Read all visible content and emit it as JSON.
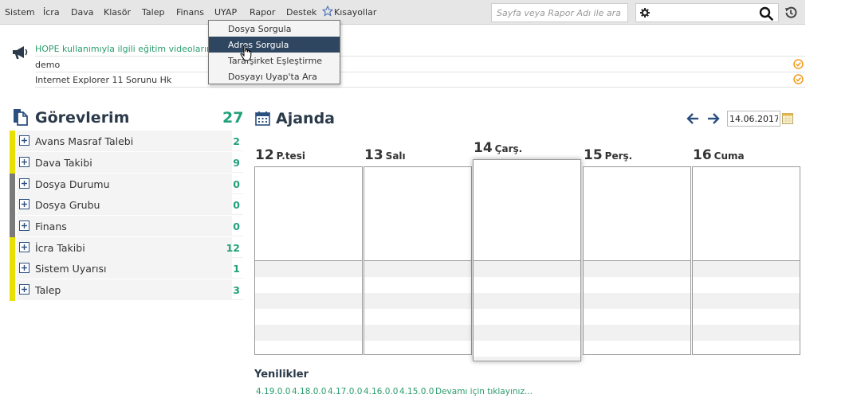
{
  "menubar": {
    "items": [
      "Sistem",
      "İcra",
      "Dava",
      "Klasör",
      "Talep",
      "Finans",
      "UYAP",
      "Rapor",
      "Destek"
    ],
    "shortcuts_label": "Kısayollar",
    "rapor_search_placeholder": "Sayfa veya Rapor Adı ile ara",
    "main_search_value": ""
  },
  "uyap_dropdown": {
    "items": [
      "Dosya Sorgula",
      "Adres Sorgula",
      "Tarafşirket Eşleştirme",
      "Dosyayı Uyap'ta Ara"
    ],
    "selected_index": 1
  },
  "announcements": [
    "HOPE kullanımıyla ilgili eğitim videolarımıza",
    "demo",
    "Internet Explorer 11 Sorunu Hk"
  ],
  "tasks": {
    "title": "Görevlerim",
    "total": "27",
    "items": [
      {
        "label": "Avans Masraf Talebi",
        "count": "2",
        "color": "#e8e000"
      },
      {
        "label": "Dava Takibi",
        "count": "9",
        "color": "#e8e000"
      },
      {
        "label": "Dosya Durumu",
        "count": "0",
        "color": "#7a7a7a"
      },
      {
        "label": "Dosya Grubu",
        "count": "0",
        "color": "#7a7a7a"
      },
      {
        "label": "Finans",
        "count": "0",
        "color": "#7a7a7a"
      },
      {
        "label": "İcra Takibi",
        "count": "12",
        "color": "#e8e000"
      },
      {
        "label": "Sistem Uyarısı",
        "count": "1",
        "color": "#e8e000"
      },
      {
        "label": "Talep",
        "count": "3",
        "color": "#e8e000"
      }
    ]
  },
  "agenda": {
    "title": "Ajanda",
    "date": "14.06.2017",
    "days": [
      {
        "num": "12",
        "name": "P.tesi"
      },
      {
        "num": "13",
        "name": "Salı"
      },
      {
        "num": "14",
        "name": "Çarş."
      },
      {
        "num": "15",
        "name": "Perş."
      },
      {
        "num": "16",
        "name": "Cuma"
      }
    ],
    "today_index": 2
  },
  "news": {
    "title": "Yenilikler",
    "versions": [
      "4.19.0.0",
      "4.18.0.0",
      "4.17.0.0",
      "4.16.0.0",
      "4.15.0.0"
    ],
    "more_label": "Devamı için tıklayınız..."
  },
  "colors": {
    "accent_green": "#22a07a",
    "dropdown_selected": "#2f4660",
    "title_dark": "#2b3a4a"
  }
}
